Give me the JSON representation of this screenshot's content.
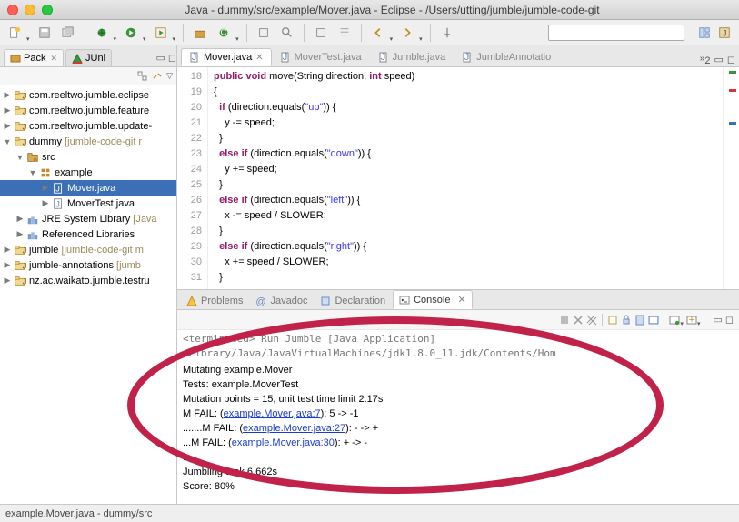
{
  "title": "Java - dummy/src/example/Mover.java - Eclipse - /Users/utting/jumble/jumble-code-git",
  "tabs": {
    "package_explorer": "Pack",
    "junit": "JUni"
  },
  "tree": [
    {
      "level": 0,
      "exp": "▶",
      "kind": "proj",
      "label": "com.reeltwo.jumble.eclipse"
    },
    {
      "level": 0,
      "exp": "▶",
      "kind": "proj",
      "label": "com.reeltwo.jumble.feature"
    },
    {
      "level": 0,
      "exp": "▶",
      "kind": "proj",
      "label": "com.reeltwo.jumble.update-"
    },
    {
      "level": 0,
      "exp": "▼",
      "kind": "proj",
      "label": "dummy",
      "suffix": "  [jumble-code-git r"
    },
    {
      "level": 1,
      "exp": "▼",
      "kind": "srcfolder",
      "label": "src"
    },
    {
      "level": 2,
      "exp": "▼",
      "kind": "package",
      "label": "example"
    },
    {
      "level": 3,
      "exp": "▶",
      "kind": "java",
      "label": "Mover.java",
      "selected": true
    },
    {
      "level": 3,
      "exp": "▶",
      "kind": "java",
      "label": "MoverTest.java"
    },
    {
      "level": 1,
      "exp": "▶",
      "kind": "lib",
      "label": "JRE System Library",
      "suffix": " [Java"
    },
    {
      "level": 1,
      "exp": "▶",
      "kind": "lib",
      "label": "Referenced Libraries"
    },
    {
      "level": 0,
      "exp": "▶",
      "kind": "proj",
      "label": "jumble",
      "suffix": "  [jumble-code-git m"
    },
    {
      "level": 0,
      "exp": "▶",
      "kind": "proj",
      "label": "jumble-annotations",
      "suffix": "  [jumb"
    },
    {
      "level": 0,
      "exp": "▶",
      "kind": "proj",
      "label": "nz.ac.waikato.jumble.testru"
    }
  ],
  "editor": {
    "tabs": [
      {
        "label": "Mover.java",
        "active": true
      },
      {
        "label": "MoverTest.java",
        "active": false
      },
      {
        "label": "Jumble.java",
        "active": false
      },
      {
        "label": "JumbleAnnotatio",
        "active": false
      }
    ],
    "more_count": "2",
    "first_line": 18,
    "lines": [
      {
        "n": 18,
        "html": "<span class='kw'>public</span> <span class='kw'>void</span> move(String direction, <span class='kw'>int</span> speed)"
      },
      {
        "n": 19,
        "html": "{"
      },
      {
        "n": 20,
        "html": "  <span class='kw'>if</span> (direction.equals(<span class='str'>\"up\"</span>)) {"
      },
      {
        "n": 21,
        "html": "    y -= speed;"
      },
      {
        "n": 22,
        "html": "  }"
      },
      {
        "n": 23,
        "html": "  <span class='kw'>else</span> <span class='kw'>if</span> (direction.equals(<span class='str'>\"down\"</span>)) {"
      },
      {
        "n": 24,
        "html": "    y += speed;"
      },
      {
        "n": 25,
        "html": "  }"
      },
      {
        "n": 26,
        "html": "  <span class='kw'>else</span> <span class='kw'>if</span> (direction.equals(<span class='str'>\"left\"</span>)) {"
      },
      {
        "n": 27,
        "html": "    x -= speed / SLOWER;"
      },
      {
        "n": 28,
        "html": "  }"
      },
      {
        "n": 29,
        "html": "  <span class='kw'>else</span> <span class='kw'>if</span> (direction.equals(<span class='str'>\"right\"</span>)) {"
      },
      {
        "n": 30,
        "html": "    x += speed / SLOWER;"
      },
      {
        "n": 31,
        "html": "  }"
      }
    ]
  },
  "bottom": {
    "tabs": [
      {
        "label": "Problems",
        "active": false,
        "icon": "warn"
      },
      {
        "label": "Javadoc",
        "active": false,
        "icon": "at"
      },
      {
        "label": "Declaration",
        "active": false,
        "icon": "decl"
      },
      {
        "label": "Console",
        "active": true,
        "icon": "console"
      }
    ],
    "term_header": "<terminated> Run Jumble [Java Application] /Library/Java/JavaVirtualMachines/jdk1.8.0_11.jdk/Contents/Hom",
    "lines": [
      {
        "t": "Mutating example.Mover"
      },
      {
        "t": "Tests: example.MoverTest"
      },
      {
        "t": "Mutation points = 15, unit test time limit 2.17s"
      },
      {
        "pre": "M FAIL: (",
        "link": "example.Mover.java:7",
        "post": "): 5 -> -1"
      },
      {
        "pre": ".......M FAIL: (",
        "link": "example.Mover.java:27",
        "post": "): - -> +"
      },
      {
        "pre": "...M FAIL: (",
        "link": "example.Mover.java:30",
        "post": "): + -> -"
      },
      {
        "t": ".."
      },
      {
        "t": "Jumbling took 6.662s"
      },
      {
        "t": "Score: 80%"
      }
    ]
  },
  "status": "example.Mover.java - dummy/src"
}
